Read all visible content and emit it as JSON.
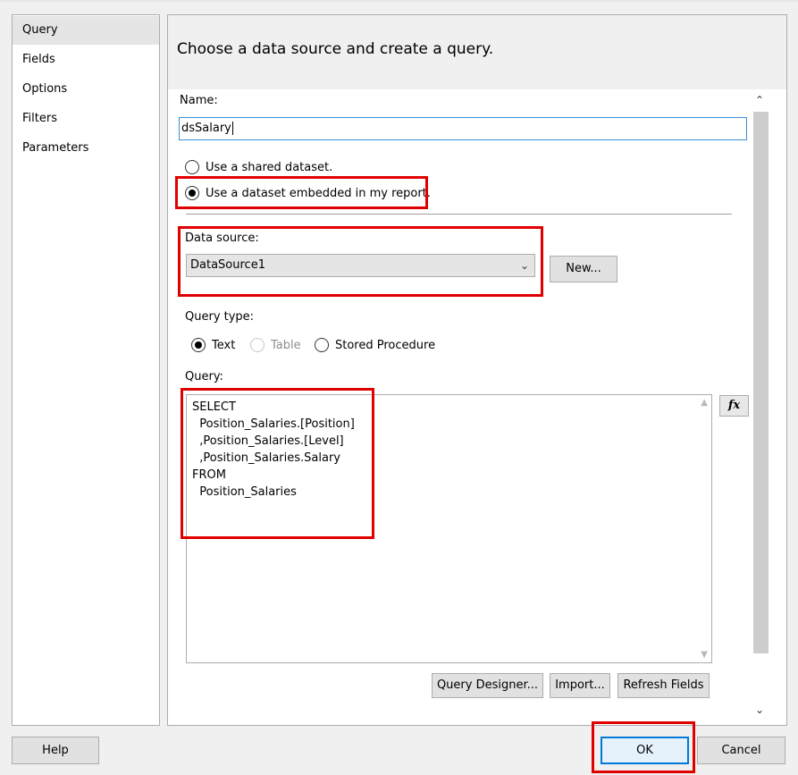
{
  "nav": {
    "items": [
      {
        "label": "Query",
        "active": true
      },
      {
        "label": "Fields"
      },
      {
        "label": "Options"
      },
      {
        "label": "Filters"
      },
      {
        "label": "Parameters"
      }
    ]
  },
  "header": {
    "title": "Choose a data source and create a query."
  },
  "form": {
    "name_label": "Name:",
    "name_value": "dsSalary",
    "radio_shared": "Use a shared dataset.",
    "radio_embedded": "Use a dataset embedded in my report.",
    "data_source_label": "Data source:",
    "data_source_value": "DataSource1",
    "new_button": "New...",
    "query_type_label": "Query type:",
    "query_type_text": "Text",
    "query_type_table": "Table",
    "query_type_sp": "Stored Procedure",
    "query_label": "Query:",
    "query_text": "SELECT\n  Position_Salaries.[Position]\n  ,Position_Salaries.[Level]\n  ,Position_Salaries.Salary\nFROM\n  Position_Salaries",
    "fx_label": "fx",
    "query_designer_button": "Query Designer...",
    "import_button": "Import...",
    "refresh_button": "Refresh Fields"
  },
  "footer": {
    "help_button": "Help",
    "ok_button": "OK",
    "cancel_button": "Cancel"
  },
  "colors": {
    "highlight": "#e00000",
    "focus_border": "#3c8fd8"
  }
}
